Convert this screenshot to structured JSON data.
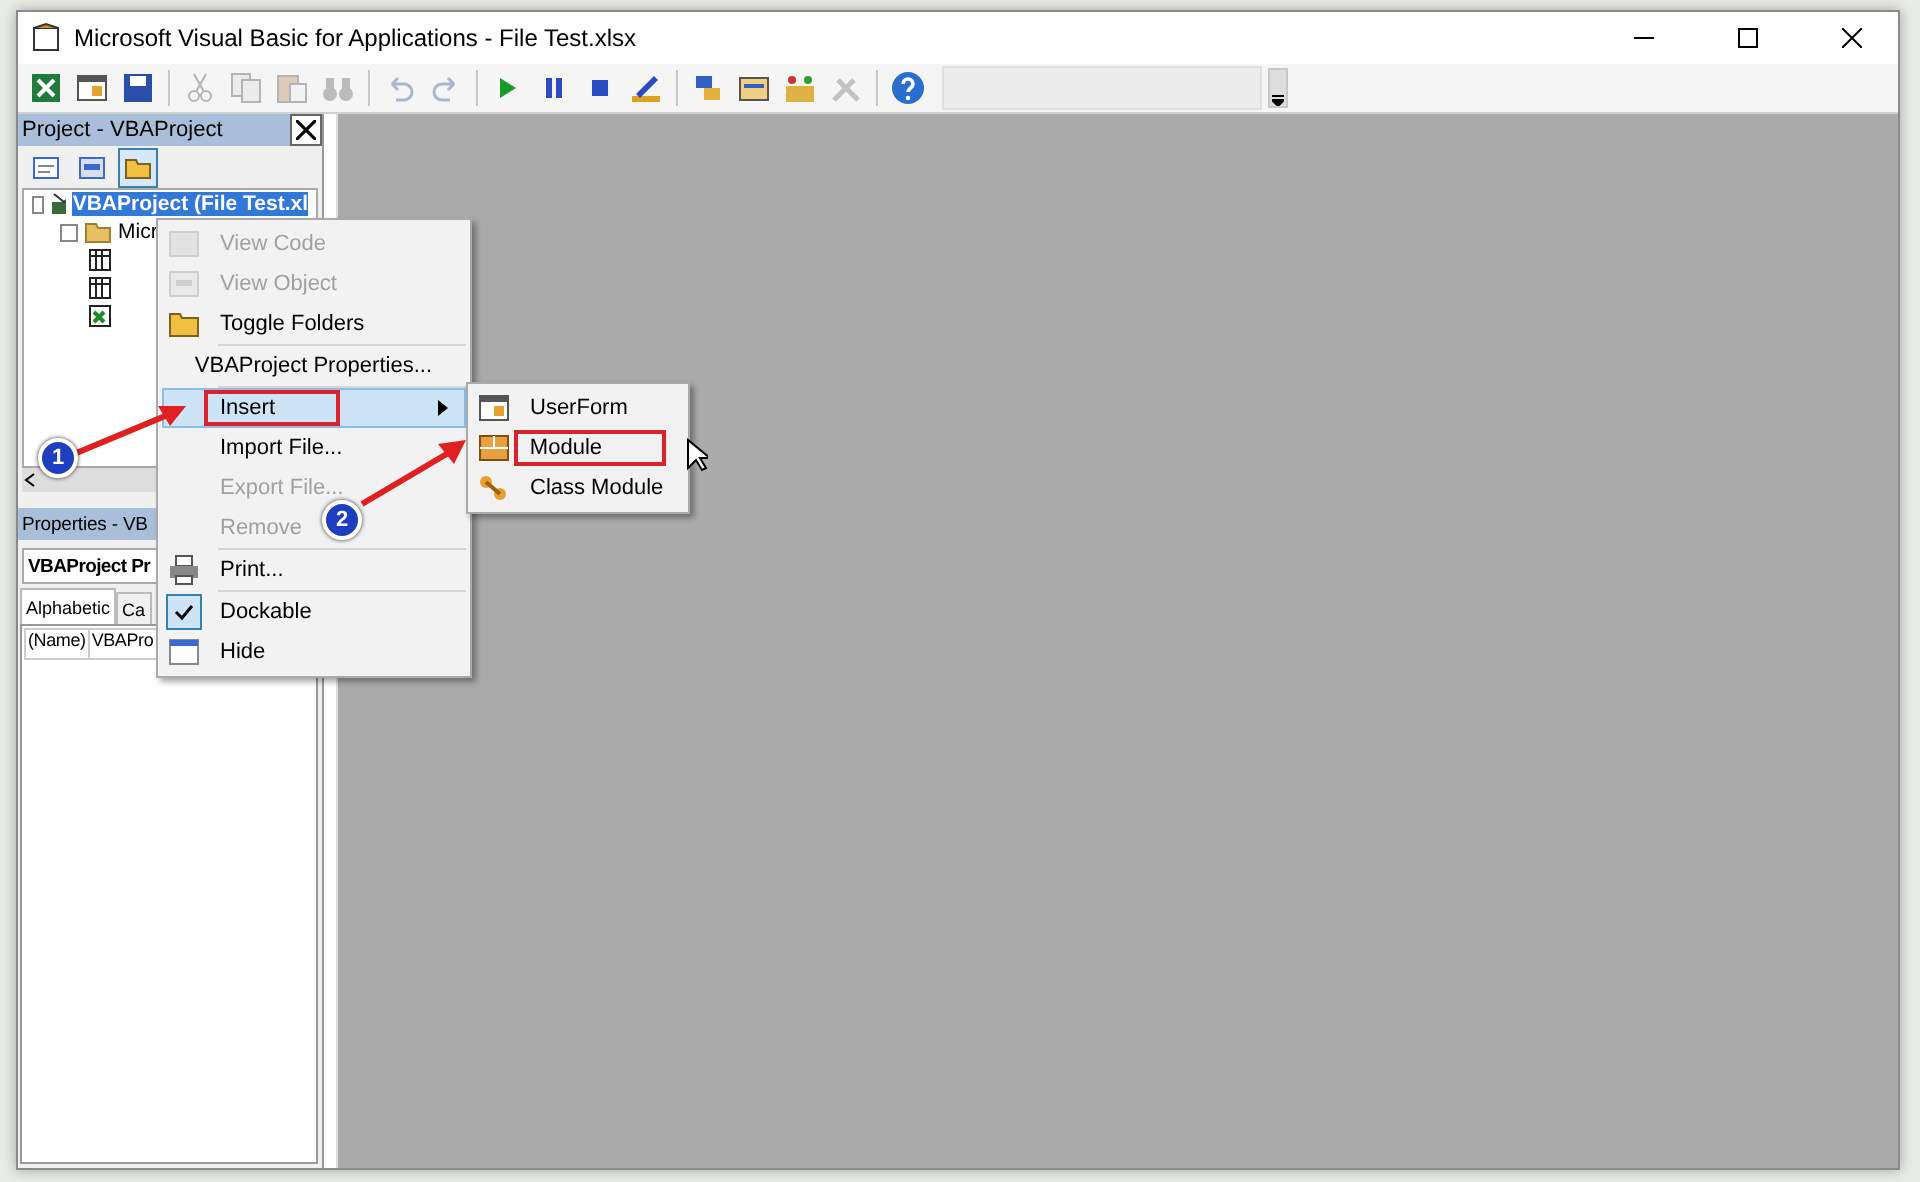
{
  "window": {
    "title": "Microsoft Visual Basic for Applications - File Test.xlsx"
  },
  "toolbar": [
    {
      "kind": "excel",
      "disabled": false
    },
    {
      "kind": "insert",
      "disabled": false
    },
    {
      "kind": "save",
      "disabled": false
    },
    {
      "kind": "sep"
    },
    {
      "kind": "cut",
      "disabled": true
    },
    {
      "kind": "copy",
      "disabled": true
    },
    {
      "kind": "paste",
      "disabled": true
    },
    {
      "kind": "find",
      "disabled": true
    },
    {
      "kind": "sep"
    },
    {
      "kind": "undo",
      "disabled": true
    },
    {
      "kind": "redo",
      "disabled": true
    },
    {
      "kind": "sep"
    },
    {
      "kind": "run",
      "disabled": false
    },
    {
      "kind": "pause",
      "disabled": false
    },
    {
      "kind": "stop",
      "disabled": false
    },
    {
      "kind": "design",
      "disabled": false
    },
    {
      "kind": "sep"
    },
    {
      "kind": "explorer",
      "disabled": false
    },
    {
      "kind": "properties",
      "disabled": false
    },
    {
      "kind": "browser",
      "disabled": false
    },
    {
      "kind": "toolbox",
      "disabled": true
    },
    {
      "kind": "sep"
    },
    {
      "kind": "help",
      "disabled": false
    }
  ],
  "project_panel": {
    "title": "Project - VBAProject",
    "tools": [
      {
        "kind": "code",
        "selected": false
      },
      {
        "kind": "object",
        "selected": false
      },
      {
        "kind": "folders",
        "selected": true
      }
    ],
    "tree": [
      {
        "label": "VBAProject (File Test.xl",
        "kind": "project",
        "selected": true,
        "expanded": true,
        "children": [
          {
            "label": "Micr",
            "kind": "folder",
            "selected": false,
            "expanded": true,
            "children": [
              {
                "kind": "sheet"
              },
              {
                "kind": "sheet"
              },
              {
                "kind": "workbook"
              }
            ]
          }
        ]
      }
    ]
  },
  "properties_panel": {
    "title": "Properties - VB",
    "object": "VBAProject Pr",
    "tabs": [
      {
        "label": "Alphabetic",
        "selected": true
      },
      {
        "label": "Ca",
        "selected": false
      }
    ],
    "rows": [
      {
        "name": "(Name)",
        "value": "VBAPro"
      }
    ]
  },
  "context_menu": [
    {
      "kind": "item",
      "label": "View Code",
      "disabled": true,
      "checked": false,
      "selected": false,
      "marked": false
    },
    {
      "kind": "item",
      "label": "View Object",
      "disabled": true,
      "checked": false,
      "selected": false,
      "marked": false
    },
    {
      "kind": "item",
      "label": "Toggle Folders",
      "disabled": false,
      "checked": false,
      "selected": false,
      "marked": false
    },
    {
      "kind": "separator"
    },
    {
      "kind": "item",
      "label": "VBAProject Properties...",
      "disabled": false,
      "checked": false,
      "selected": false,
      "marked": false
    },
    {
      "kind": "separator"
    },
    {
      "kind": "submenu",
      "label": "Insert",
      "disabled": false,
      "checked": false,
      "selected": true,
      "marked": true
    },
    {
      "kind": "item",
      "label": "Import File...",
      "disabled": false,
      "checked": false,
      "selected": false,
      "marked": false
    },
    {
      "kind": "item",
      "label": "Export File...",
      "disabled": true,
      "checked": false,
      "selected": false,
      "marked": false
    },
    {
      "kind": "item",
      "label": "Remove",
      "disabled": true,
      "checked": false,
      "selected": false,
      "marked": false
    },
    {
      "kind": "separator"
    },
    {
      "kind": "item",
      "label": "Print...",
      "disabled": false,
      "checked": false,
      "selected": false,
      "marked": false
    },
    {
      "kind": "separator"
    },
    {
      "kind": "item",
      "label": "Dockable",
      "disabled": false,
      "checked": true,
      "selected": false,
      "marked": false
    },
    {
      "kind": "item",
      "label": "Hide",
      "disabled": false,
      "checked": false,
      "selected": false,
      "marked": false
    }
  ],
  "submenu": [
    {
      "label": "UserForm",
      "selected": false,
      "marked": false
    },
    {
      "label": "Module",
      "selected": false,
      "marked": true
    },
    {
      "label": "Class Module",
      "selected": false,
      "marked": false
    }
  ],
  "callouts": [
    {
      "label": "1"
    },
    {
      "label": "2"
    }
  ]
}
